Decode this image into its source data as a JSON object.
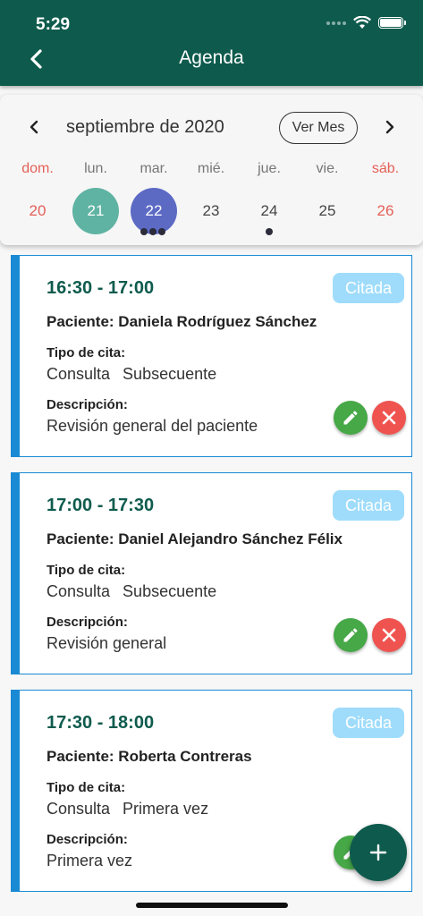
{
  "status_bar": {
    "time": "5:29"
  },
  "header": {
    "title": "Agenda"
  },
  "calendar": {
    "month_label": "septiembre de 2020",
    "view_month_label": "Ver Mes",
    "weekdays": [
      "dom.",
      "lun.",
      "mar.",
      "mié.",
      "jue.",
      "vie.",
      "sáb."
    ],
    "days": [
      "20",
      "21",
      "22",
      "23",
      "24",
      "25",
      "26"
    ],
    "today_index": 1,
    "selected_index": 2
  },
  "appointments": [
    {
      "time": "16:30 - 17:00",
      "status": "Citada",
      "patient": "Paciente: Daniela Rodríguez Sánchez",
      "type_label": "Tipo de cita:",
      "type_category": "Consulta",
      "type_value": "Subsecuente",
      "description_label": "Descripción:",
      "description": "Revisión general del paciente"
    },
    {
      "time": "17:00 - 17:30",
      "status": "Citada",
      "patient": "Paciente: Daniel Alejandro Sánchez Félix",
      "type_label": "Tipo de cita:",
      "type_category": "Consulta",
      "type_value": "Subsecuente",
      "description_label": "Descripción:",
      "description": "Revisión general"
    },
    {
      "time": "17:30 - 18:00",
      "status": "Citada",
      "patient": "Paciente: Roberta Contreras",
      "type_label": "Tipo de cita:",
      "type_category": "Consulta",
      "type_value": "Primera vez",
      "description_label": "Descripción:",
      "description": "Primera vez"
    }
  ],
  "colors": {
    "primary": "#0e5b4d",
    "accent_blue": "#1a8ad4",
    "badge": "#9fdcfb",
    "edit": "#46a847",
    "delete": "#ef5350",
    "weekend": "#e45f57",
    "today": "#5fb3a3",
    "selected": "#5c6ac4"
  },
  "icons": {
    "back": "chevron-left-icon",
    "prev": "chevron-left-icon",
    "next": "chevron-right-icon",
    "edit": "pencil-icon",
    "delete": "close-icon",
    "add": "plus-icon"
  }
}
